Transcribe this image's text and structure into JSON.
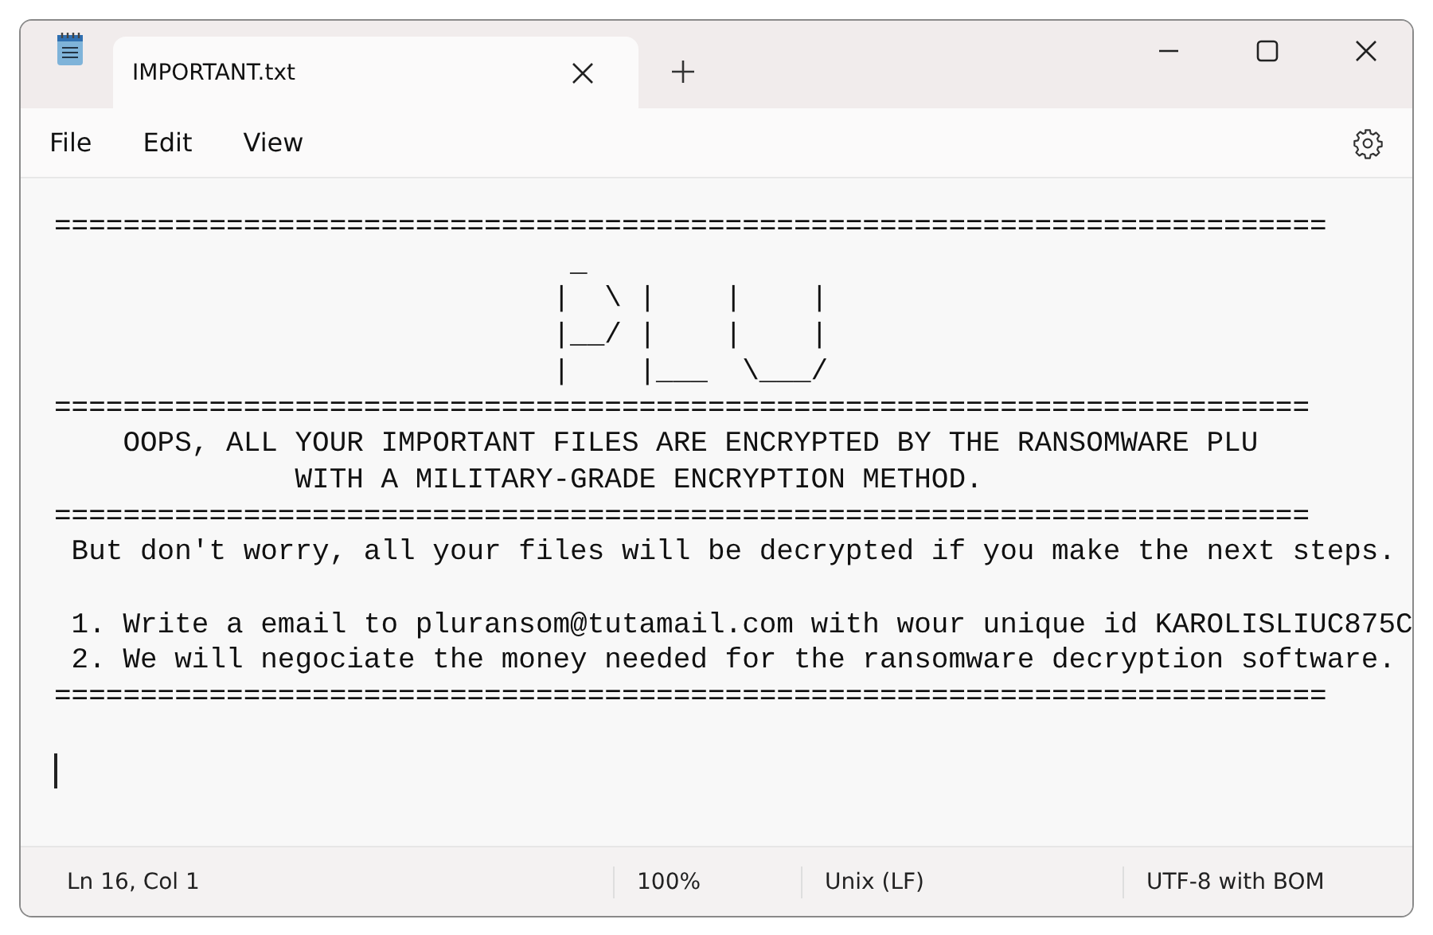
{
  "tab": {
    "title": "IMPORTANT.txt"
  },
  "menu": [
    "File",
    "Edit",
    "View"
  ],
  "document": {
    "blocks": [
      [
        "==========================================================================",
        "                              _",
        "                             |  \\ |    |    |",
        "                             |__/ |    |    |",
        "                             |    |___  \\___/",
        "=========================================================================",
        "    OOPS, ALL YOUR IMPORTANT FILES ARE ENCRYPTED BY THE RANSOMWARE PLU",
        "              WITH A MILITARY-GRADE ENCRYPTION METHOD.",
        "=========================================================================",
        " But don't worry, all your files will be decrypted if you make the next steps."
      ],
      [
        " 1. Write a email to pluransom@tutamail.com with wour unique id KAROLISLIUC875C",
        " 2. We will negociate the money needed for the ransomware decryption software.",
        "=========================================================================="
      ]
    ]
  },
  "status_bar": [
    "Ln 16, Col 1",
    "100%",
    "Unix (LF)",
    "UTF-8 with BOM"
  ]
}
